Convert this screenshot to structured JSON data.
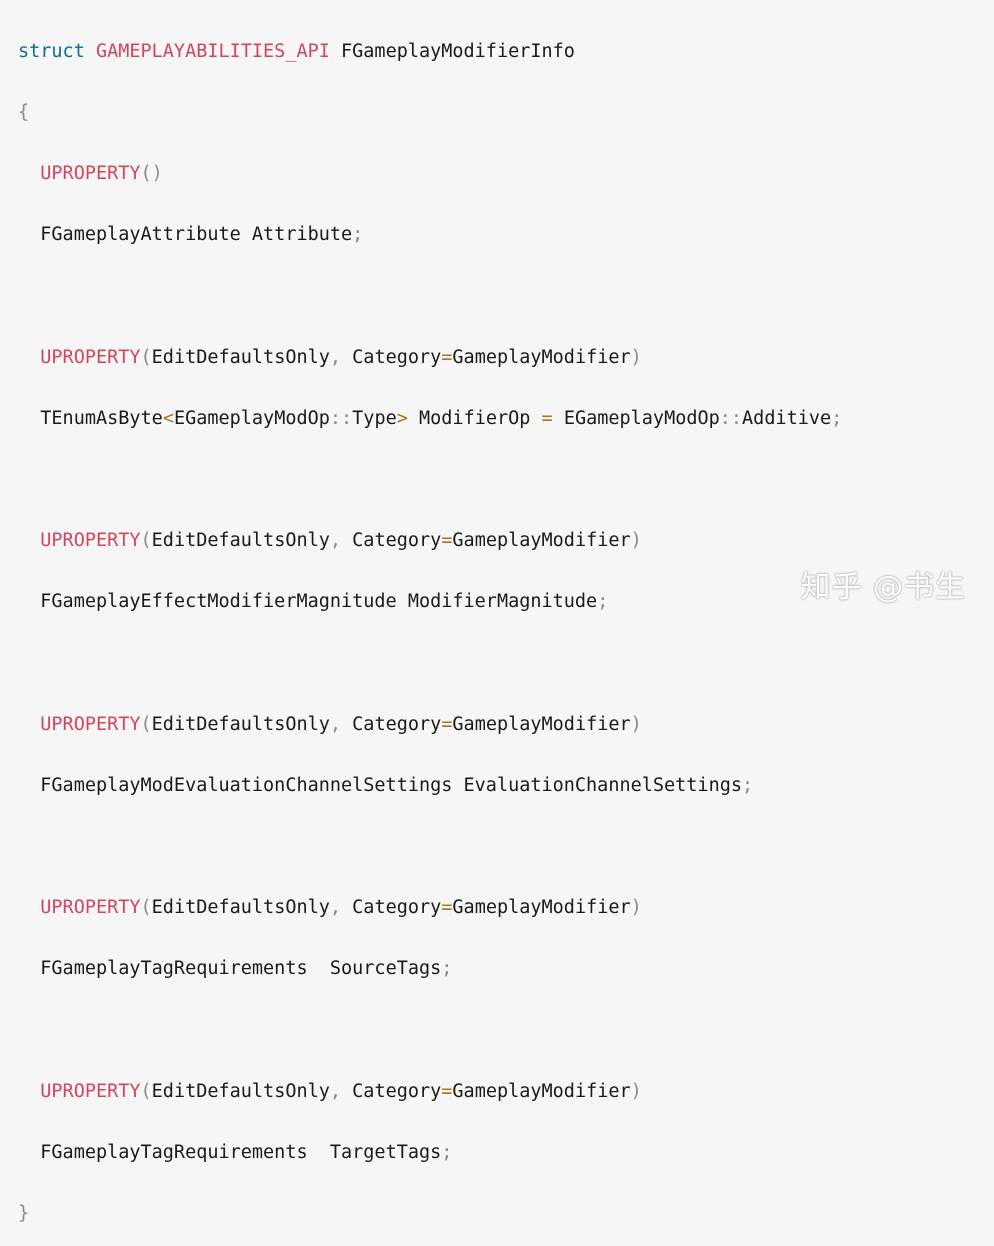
{
  "code": {
    "struct_kw": "struct",
    "api_macro": "GAMEPLAYABILITIES_API",
    "struct_name": "FGameplayModifierInfo",
    "open_brace": "{",
    "close_brace": "}",
    "uproperty": "UPROPERTY",
    "lparen": "(",
    "rparen": ")",
    "empty_parens": "()",
    "specifier": "EditDefaultsOnly",
    "comma": ",",
    "category_key": "Category",
    "eq": "=",
    "category_value": "GameplayModifier",
    "semicolon": ";",
    "attr_type": "FGameplayAttribute",
    "attr_name": "Attribute",
    "tenum": "TEnumAsByte",
    "lt": "<",
    "gt": ">",
    "enum_type": "EGameplayModOp",
    "scope": "::",
    "type_word": "Type",
    "modop_name": "ModifierOp",
    "enum_default_owner": "EGameplayModOp",
    "enum_default": "Additive",
    "mag_type": "FGameplayEffectModifierMagnitude",
    "mag_name": "ModifierMagnitude",
    "eval_type": "FGameplayModEvaluationChannelSettings",
    "eval_name": "EvaluationChannelSettings",
    "tagreq_type": "FGameplayTagRequirements",
    "source_name": "SourceTags",
    "target_name": "TargetTags"
  },
  "watermark": "知乎 @书生",
  "colors": {
    "background": "#f6f6f6",
    "keyword": "#0e6e8a",
    "macro": "#d0455f",
    "operator": "#a8731a",
    "punctuation": "#8a8a8a",
    "text": "#1a1a1a"
  }
}
